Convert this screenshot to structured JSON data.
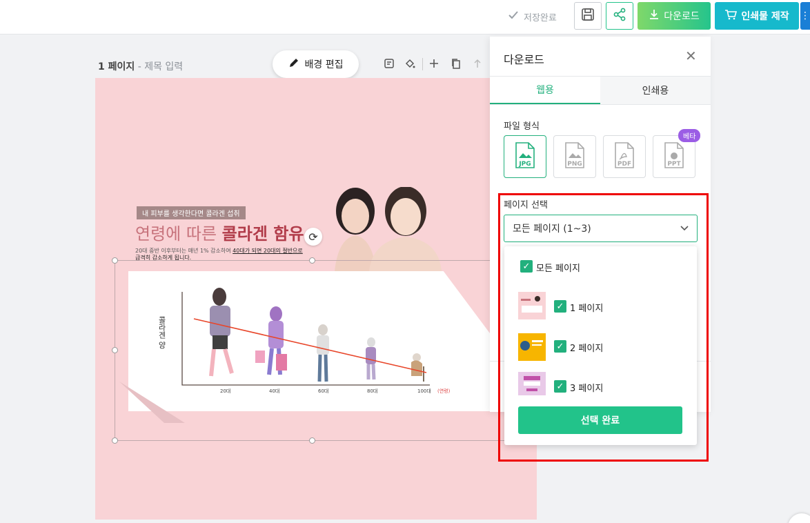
{
  "topbar": {
    "saved_label": "저장완료",
    "download_label": "다운로드",
    "print_label": "인쇄물 제작"
  },
  "editor": {
    "page_label": "1 페이지",
    "title_placeholder": "- 제목 입력",
    "bg_edit_label": "배경 편집"
  },
  "design": {
    "tag": "내 피부를 생각한다면 콜라겐 섭취",
    "headline_normal": "연령에 따른",
    "headline_bold": "콜라겐 함유",
    "desc_part1": "20대 중반 이후부터는 매년 1% 감소하여",
    "desc_underline": "40대가 되면 20대의 절반으로",
    "desc_part2": "급격히 감소하게 됩니다.",
    "y_axis_label": "콜라겐 양",
    "x_ticks": [
      "20대",
      "40대",
      "60대",
      "80대",
      "100대"
    ],
    "x_unit": "(연령)"
  },
  "panel": {
    "title": "다운로드",
    "tabs": [
      "웹용",
      "인쇄용"
    ],
    "format_label": "파일 형식",
    "formats": [
      "JPG",
      "PNG",
      "PDF",
      "PPT"
    ],
    "beta_badge": "베타",
    "page_select_label": "페이지 선택",
    "page_select_value": "모든 페이지 (1~3)"
  },
  "dropdown": {
    "all_pages": "모든 페이지",
    "pages": [
      "1 페이지",
      "2 페이지",
      "3 페이지"
    ],
    "confirm_label": "선택 완료"
  },
  "colors": {
    "accent_green": "#22b07d",
    "print_blue": "#16b9cc",
    "canvas_pink": "#f9d3d6",
    "highlight_red": "#e00000"
  }
}
